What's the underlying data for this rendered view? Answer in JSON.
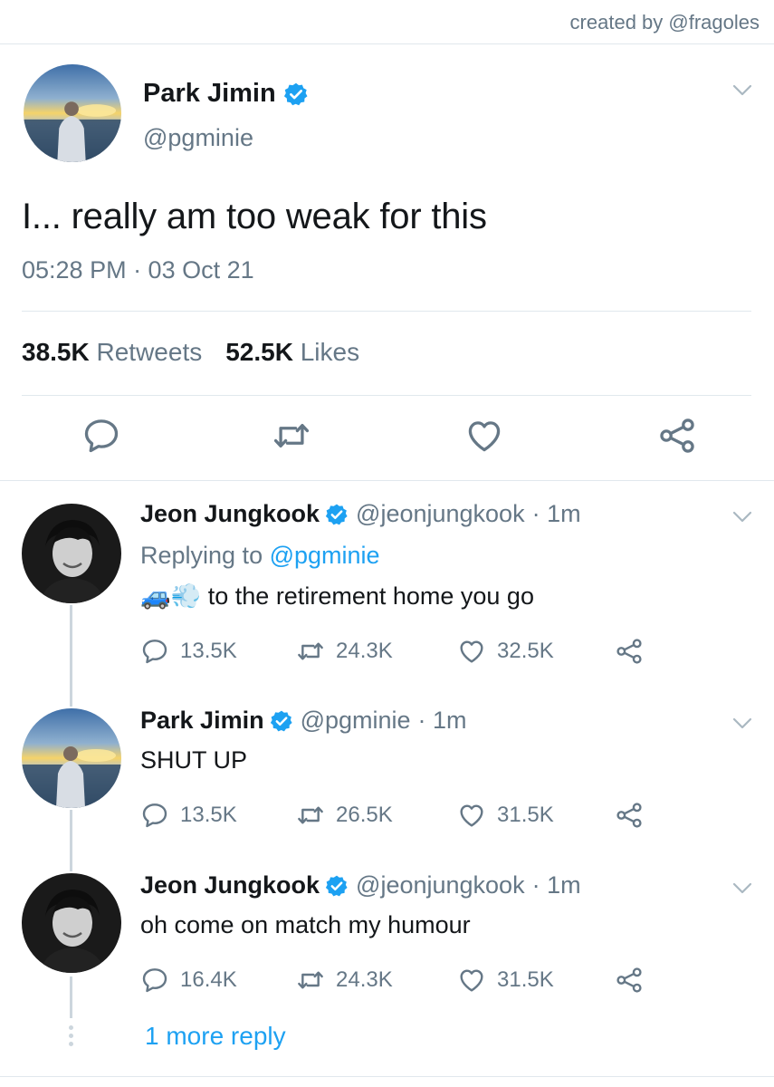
{
  "credit": "created by @fragoles",
  "main_tweet": {
    "author_name": "Park Jimin",
    "author_handle": "@pgminie",
    "text": "I... really am too weak for this",
    "timestamp": "05:28 PM · 03 Oct 21",
    "retweets_count": "38.5K",
    "retweets_label": "Retweets",
    "likes_count": "52.5K",
    "likes_label": "Likes",
    "verified": true
  },
  "replies": [
    {
      "author_name": "Jeon Jungkook",
      "author_handle": "@jeonjungkook",
      "time": "· 1m",
      "replying_prefix": "Replying to",
      "replying_to": "@pgminie",
      "emoji": "🚙💨",
      "text": "to the retirement home you go",
      "reply_count": "13.5K",
      "retweet_count": "24.3K",
      "like_count": "32.5K"
    },
    {
      "author_name": "Park Jimin",
      "author_handle": "@pgminie",
      "time": "· 1m",
      "text": "SHUT UP",
      "reply_count": "13.5K",
      "retweet_count": "26.5K",
      "like_count": "31.5K"
    },
    {
      "author_name": "Jeon Jungkook",
      "author_handle": "@jeonjungkook",
      "time": "· 1m",
      "text": "oh come on match my humour",
      "reply_count": "16.4K",
      "retweet_count": "24.3K",
      "like_count": "31.5K"
    }
  ],
  "more_replies_label": "1 more reply",
  "icons": [
    "reply-icon",
    "retweet-icon",
    "like-icon",
    "share-icon",
    "verified-badge-icon",
    "chevron-down-icon"
  ],
  "colors": {
    "accent": "#1da1f2",
    "text_primary": "#14171a",
    "text_secondary": "#657786",
    "divider": "#e1e8ed",
    "thread_line": "#ccd6dd"
  }
}
